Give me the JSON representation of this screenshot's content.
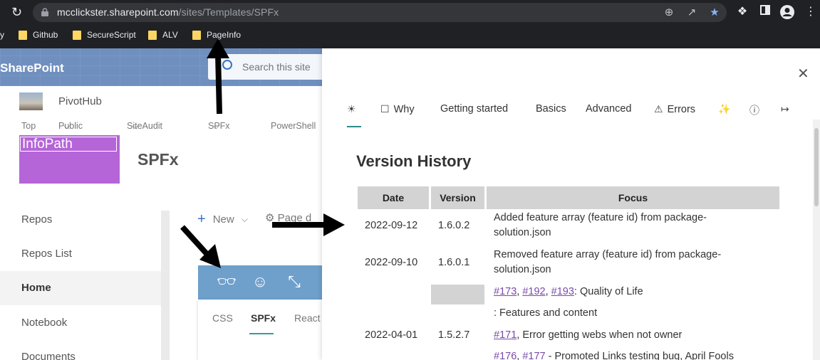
{
  "browser": {
    "url_host": "mcclickster.sharepoint.com",
    "url_path": "/sites/Templates/SPFx",
    "bookmarks": [
      {
        "label": "y"
      },
      {
        "label": "Github"
      },
      {
        "label": "SecureScript"
      },
      {
        "label": "ALV"
      },
      {
        "label": "PageInfo"
      }
    ]
  },
  "sharepoint": {
    "brand": "SharePoint",
    "search_placeholder": "Search this site",
    "hub_name": "PivotHub",
    "hub_nav": [
      "Top",
      "Public",
      "SiteAudit",
      "SPFx",
      "PowerShell"
    ],
    "site_logo_text": "InfoPath",
    "site_title": "SPFx",
    "left_nav": [
      "Repos",
      "Repos List",
      "Home",
      "Notebook",
      "Documents"
    ],
    "new_label": "New",
    "page_label": "Page d",
    "card_tabs": [
      "CSS",
      "SPFx",
      "React"
    ]
  },
  "panel": {
    "tabs": [
      {
        "label": "",
        "icon": "bug-icon"
      },
      {
        "label": "Why",
        "icon": "chat-icon"
      },
      {
        "label": "Getting started",
        "icon": ""
      },
      {
        "label": "Basics",
        "icon": ""
      },
      {
        "label": "Advanced",
        "icon": ""
      },
      {
        "label": "Errors",
        "icon": "warning-icon"
      },
      {
        "label": "",
        "icon": "wand-icon"
      },
      {
        "label": "",
        "icon": "info-icon"
      },
      {
        "label": "",
        "icon": "exit-icon"
      }
    ],
    "title": "Version History",
    "table": {
      "headers": [
        "Date",
        "Version",
        "Focus"
      ],
      "rows": [
        {
          "date": "2022-09-12",
          "version": "1.6.0.2",
          "focus": "Added feature array (feature id) from package-solution.json"
        },
        {
          "date": "2022-09-10",
          "version": "1.6.0.1",
          "focus": "Removed feature array (feature id) from package-solution.json"
        },
        {
          "link1": "#173",
          "link2": "#192",
          "link3": "#193",
          "focus_tail": ": Quality of Life"
        },
        {
          "focus": ": Features and content"
        },
        {
          "date": "2022-04-01",
          "version": "1.5.2.7",
          "link": "#171",
          "focus_tail": ", Error getting webs when not owner"
        },
        {
          "link1": "#176",
          "link2": "#177",
          "focus_tail": " - Promoted Links testing bug, April Fools"
        }
      ]
    }
  }
}
